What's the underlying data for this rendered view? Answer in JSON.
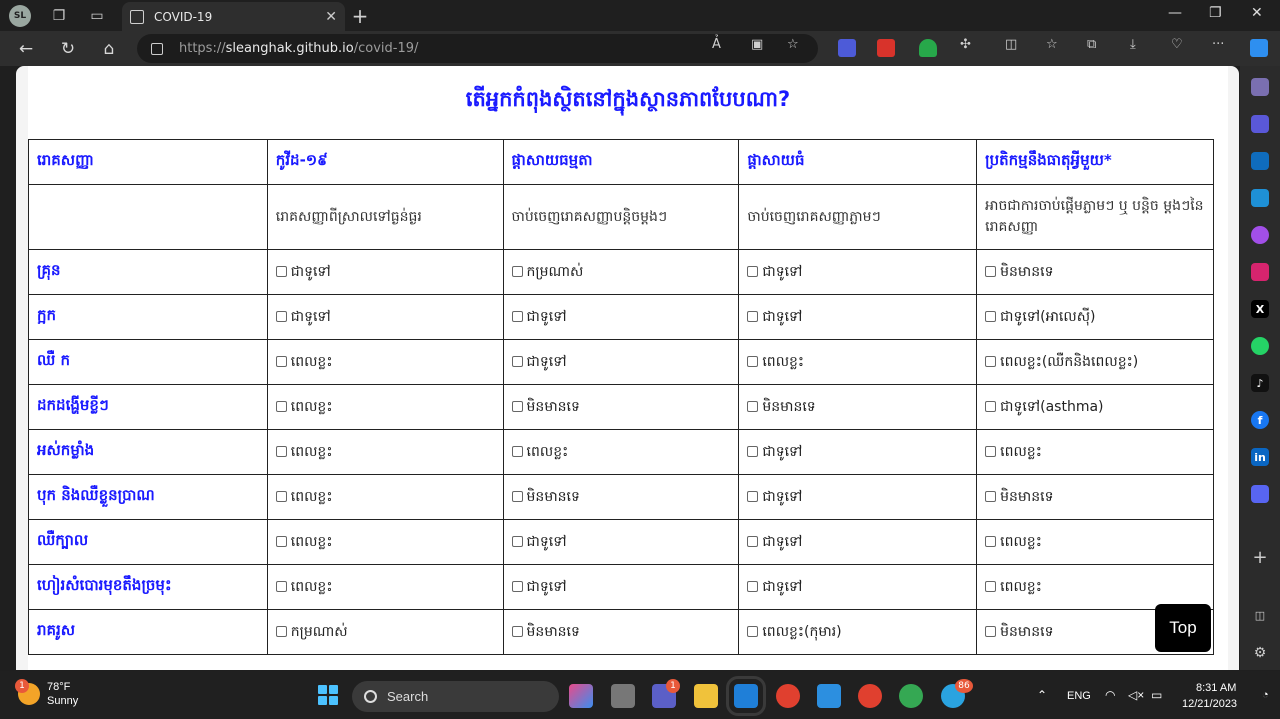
{
  "browser": {
    "profile_initials": "SL",
    "tab_title": "COVID-19",
    "url_prefix": "https://",
    "url_host": "sleanghak.github.io",
    "url_path": "/covid-19/",
    "reader_label": "Ả"
  },
  "page": {
    "title": "តើអ្នកកំពុងស្ថិតនៅក្នុងស្ថានភាពបែបណា?",
    "headers": [
      "រោគសញ្ញា",
      "កូវីដ-១៩",
      "ផ្តាសាយធម្មតា",
      "ផ្តាសាយធំ",
      "ប្រតិកម្មនឹងធាតុអ្វីមួយ*"
    ],
    "descriptions": [
      "",
      "រោគសញ្ញាពីស្រាលទៅធ្ងន់ធ្ងរ",
      "ចាប់ចេញរោគសញ្ញាបន្តិចម្តងៗ",
      "ចាប់ចេញរោគសញ្ញាភ្លាមៗ",
      "អាចជាការចាប់ផ្តើមភ្លាមៗ ឬ បន្តិច ម្តងៗនៃរោគសញ្ញា"
    ],
    "rows": [
      {
        "symptom": "គ្រុន",
        "values": [
          "ជាទូទៅ",
          "កម្រណាស់",
          "ជាទូទៅ",
          "មិនមានទេ"
        ]
      },
      {
        "symptom": "ក្អក",
        "values": [
          "ជាទូទៅ",
          "ជាទូទៅ",
          "ជាទូទៅ",
          "ជាទូទៅ(អាលេស៊ី)"
        ]
      },
      {
        "symptom": "ឈឺ ក",
        "values": [
          "ពេលខ្លះ",
          "ជាទូទៅ",
          "ពេលខ្លះ",
          "ពេលខ្លះ(ឈឺកនិងពេលខ្លះ)"
        ]
      },
      {
        "symptom": "ដកដង្ហើមខ្លីៗ",
        "values": [
          "ពេលខ្លះ",
          "មិនមានទេ",
          "មិនមានទេ",
          "ជាទូទៅ(asthma)"
        ]
      },
      {
        "symptom": "អស់កម្លាំង",
        "values": [
          "ពេលខ្លះ",
          "ពេលខ្លះ",
          "ជាទូទៅ",
          "ពេលខ្លះ"
        ]
      },
      {
        "symptom": "បុក និងឈឺខ្លួនប្រាណ",
        "values": [
          "ពេលខ្លះ",
          "មិនមានទេ",
          "ជាទូទៅ",
          "មិនមានទេ"
        ]
      },
      {
        "symptom": "ឈឺក្បាល",
        "values": [
          "ពេលខ្លះ",
          "ជាទូទៅ",
          "ជាទូទៅ",
          "ពេលខ្លះ"
        ]
      },
      {
        "symptom": "ហៀរសំបោរមុខតឹងច្រមុះ",
        "values": [
          "ពេលខ្លះ",
          "ជាទូទៅ",
          "ជាទូទៅ",
          "ពេលខ្លះ"
        ]
      },
      {
        "symptom": "រាគរូស",
        "values": [
          "កម្រណាស់",
          "មិនមានទេ",
          "ពេលខ្លះ(កុមារ)",
          "មិនមានទេ"
        ]
      }
    ],
    "top_button": "Top"
  },
  "taskbar": {
    "weather_temp": "78°F",
    "weather_desc": "Sunny",
    "weather_badge": "1",
    "search_label": "Search",
    "lang": "ENG",
    "time": "8:31 AM",
    "date": "12/21/2023",
    "teams_badge": "1",
    "telegram_badge": "86"
  }
}
